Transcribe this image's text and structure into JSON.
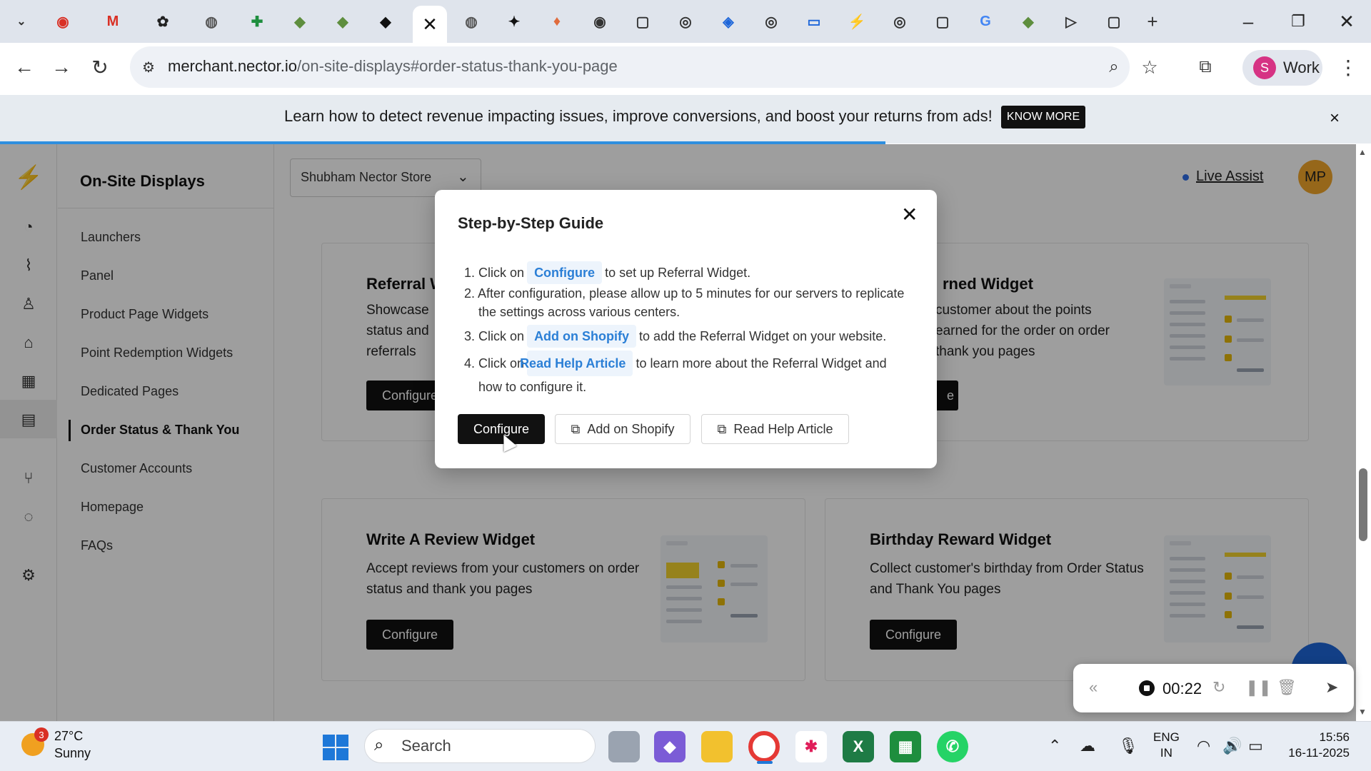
{
  "browser": {
    "tabs": [
      {
        "icon": "recording-tab-icon",
        "glyph": "◉",
        "color": "#d93025"
      },
      {
        "icon": "gmail-tab-icon",
        "glyph": "M",
        "color": "#d93025"
      },
      {
        "icon": "chatgpt-tab-icon",
        "glyph": "✿",
        "color": "#222222"
      },
      {
        "icon": "globe-tab-icon",
        "glyph": "◍",
        "color": "#555555"
      },
      {
        "icon": "sheets-tab-icon",
        "glyph": "✚",
        "color": "#1e8e3e"
      },
      {
        "icon": "shopify-tab-icon",
        "glyph": "◆",
        "color": "#5e8e3e"
      },
      {
        "icon": "shopify-tab-icon",
        "glyph": "◆",
        "color": "#5e8e3e"
      },
      {
        "icon": "shopify-tab-icon",
        "glyph": "◆",
        "color": "#111111"
      }
    ],
    "active_tab_close": "✕",
    "url_host": "merchant.nector.io",
    "url_path": "/on-site-displays#order-status-thank-you-page",
    "profile_initial": "S",
    "profile_label": "Work"
  },
  "banner": {
    "text": "Learn how to detect revenue impacting issues, improve conversions, and boost your returns from ads!",
    "button": "KNOW MORE",
    "close": "×"
  },
  "sidebar": {
    "title": "On-Site Displays",
    "items": [
      {
        "label": "Launchers"
      },
      {
        "label": "Panel"
      },
      {
        "label": "Product Page Widgets"
      },
      {
        "label": "Point Redemption Widgets"
      },
      {
        "label": "Dedicated Pages"
      },
      {
        "label": "Order Status & Thank You"
      },
      {
        "label": "Customer Accounts"
      },
      {
        "label": "Homepage"
      },
      {
        "label": "FAQs"
      }
    ],
    "active_index": 5
  },
  "header": {
    "store": "Shubham Nector Store",
    "live_assist": "Live Assist",
    "user_initials": "MP"
  },
  "cards": [
    {
      "title": "Referral W",
      "desc": "Showcase status and referrals",
      "button": "Configure"
    },
    {
      "title": "rned Widget",
      "desc": "customer about the points earned for the order on order thank you pages",
      "button": "e"
    },
    {
      "title": "Write A Review Widget",
      "desc": "Accept reviews from your customers on order status and thank you pages",
      "button": "Configure"
    },
    {
      "title": "Birthday Reward Widget",
      "desc": "Collect customer's birthday from Order Status and Thank You pages",
      "button": "Configure"
    }
  ],
  "modal": {
    "title": "Step-by-Step Guide",
    "close": "✕",
    "steps": {
      "s1_num": "1.",
      "s1_pre": "Click on",
      "s1_chip": "Configure",
      "s1_post": "to set up Referral Widget.",
      "s2_num": "2.",
      "s2_text": "After configuration, please allow up to 5 minutes for our servers to replicate the settings across various centers.",
      "s3_num": "3.",
      "s3_pre": "Click on",
      "s3_chip": "Add on Shopify",
      "s3_post": "to add the Referral Widget on your website.",
      "s4_num": "4.",
      "s4_pre": "Click on",
      "s4_chip": "Read Help Article",
      "s4_post": "to learn more about the Referral Widget and how to configure it."
    },
    "buttons": {
      "configure": "Configure",
      "add_shopify": "Add on Shopify",
      "read_help": "Read Help Article"
    }
  },
  "recorder": {
    "time": "00:22"
  },
  "taskbar": {
    "weather_badge": "3",
    "temperature": "27°C",
    "condition": "Sunny",
    "search": "Search",
    "lang_top": "ENG",
    "lang_bottom": "IN",
    "time": "15:56",
    "date": "16-11-2025"
  }
}
